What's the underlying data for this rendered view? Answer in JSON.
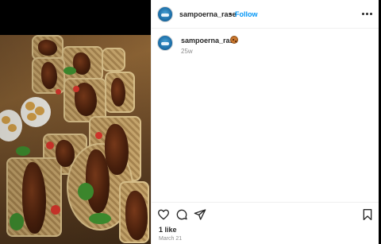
{
  "post": {
    "username": "sampoerna_rase",
    "dot": "•",
    "follow_label": "Follow",
    "more_icon": "more-horizontal-icon",
    "caption_username": "sampoerna_rase",
    "caption_emoji": "cookie-icon",
    "age": "25w",
    "likes": "1 like",
    "date": "March 21"
  },
  "actions": {
    "like_icon": "heart-icon",
    "comment_icon": "comment-icon",
    "share_icon": "share-icon",
    "save_icon": "bookmark-icon"
  },
  "colors": {
    "accent": "#0095f6",
    "text": "#262626",
    "muted": "#8e8e8e"
  }
}
